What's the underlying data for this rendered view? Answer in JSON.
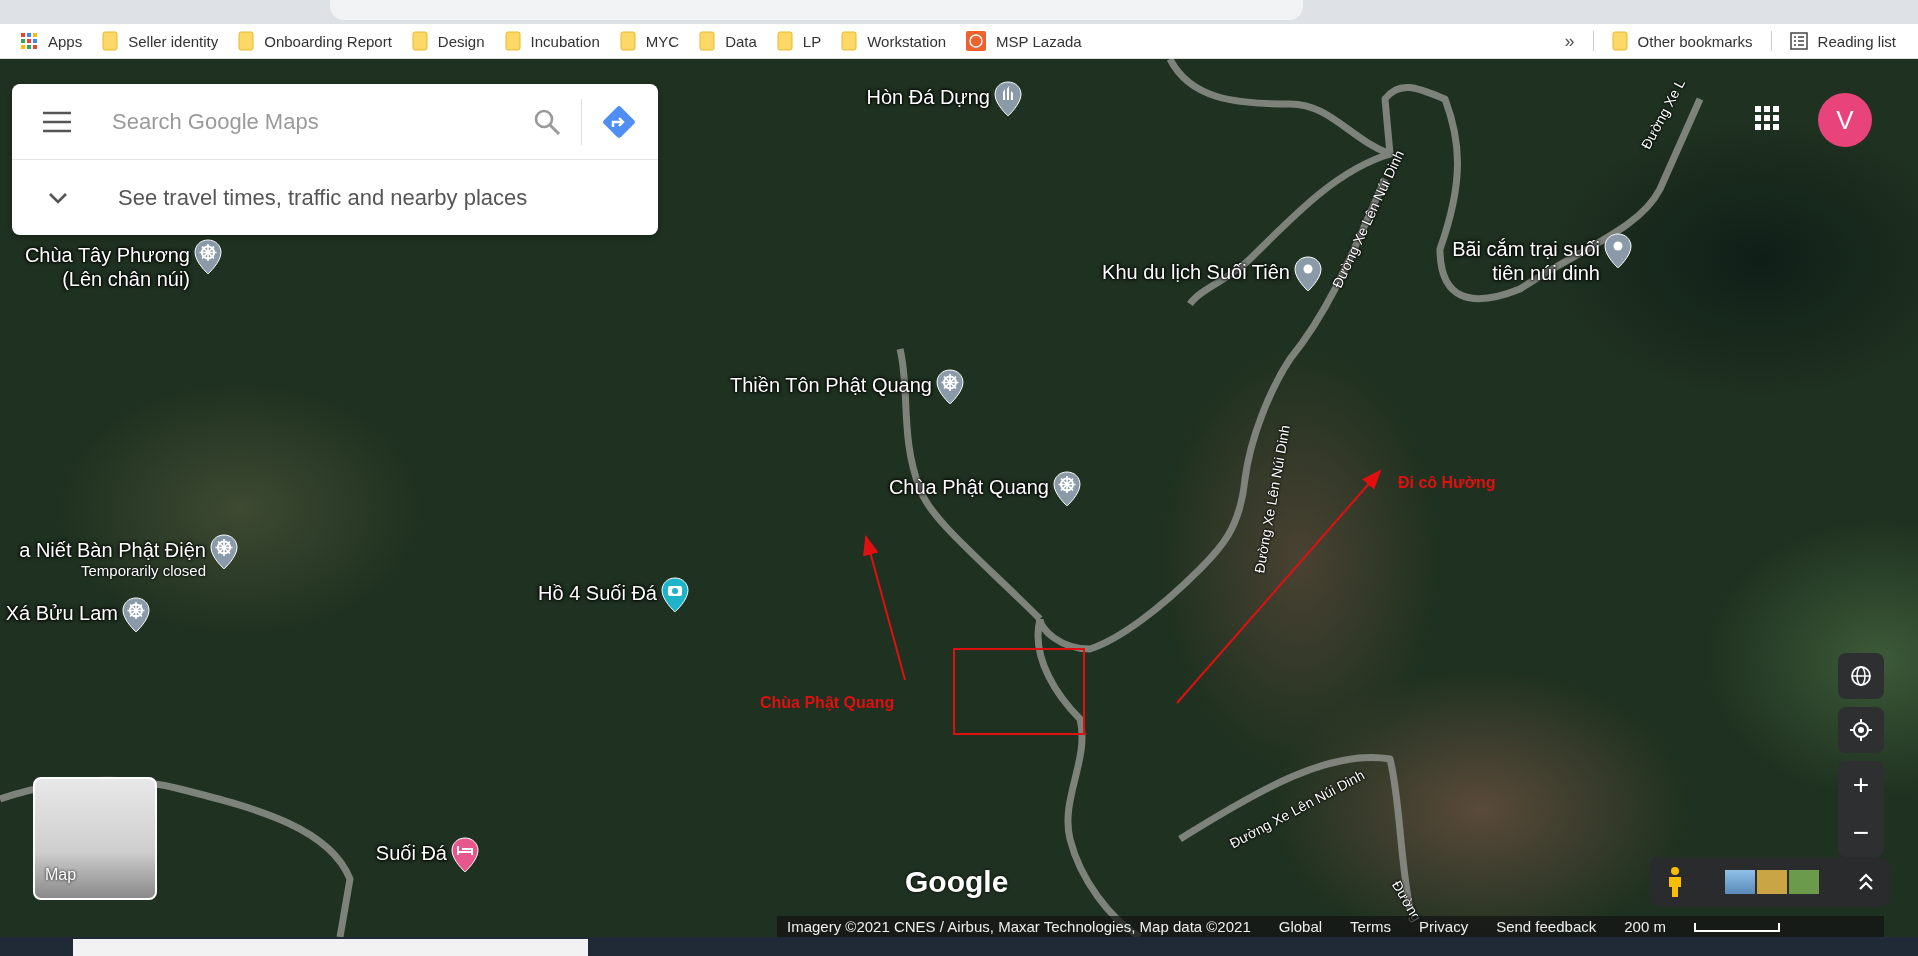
{
  "browser": {
    "bookmarks": [
      {
        "label": "Apps",
        "kind": "apps"
      },
      {
        "label": "Seller identity",
        "kind": "folder"
      },
      {
        "label": "Onboarding Report",
        "kind": "folder"
      },
      {
        "label": "Design",
        "kind": "folder"
      },
      {
        "label": "Incubation",
        "kind": "folder"
      },
      {
        "label": "MYC",
        "kind": "folder"
      },
      {
        "label": "Data",
        "kind": "folder"
      },
      {
        "label": "LP",
        "kind": "folder"
      },
      {
        "label": "Workstation",
        "kind": "folder"
      },
      {
        "label": "MSP Lazada",
        "kind": "site"
      }
    ],
    "overflow": "»",
    "other_bookmarks": "Other bookmarks",
    "reading_list": "Reading list"
  },
  "map": {
    "search": {
      "placeholder": "Search Google Maps"
    },
    "travel_prompt": "See travel times, traffic and nearby places",
    "account_initial": "V",
    "places": [
      {
        "lines": [
          "Hòn Đá Dựng"
        ],
        "kind": "landmark"
      },
      {
        "lines": [
          "Chùa Tây Phương",
          "(Lên chân núi)"
        ],
        "kind": "temple"
      },
      {
        "lines": [
          "Khu du lịch Suối Tiên"
        ],
        "kind": "pin"
      },
      {
        "lines": [
          "Bãi cắm trại suối",
          "tiên núi dinh"
        ],
        "kind": "pin"
      },
      {
        "lines": [
          "Thiền Tôn Phật Quang"
        ],
        "kind": "temple"
      },
      {
        "lines": [
          "Chùa Phật Quang"
        ],
        "kind": "temple"
      },
      {
        "lines": [
          "a Niết Bàn Phật Điện"
        ],
        "note": "Temporarily closed",
        "kind": "temple"
      },
      {
        "lines": [
          "Hồ 4 Suối Đá"
        ],
        "kind": "camera"
      },
      {
        "lines": [
          "Xá Bửu Lam"
        ],
        "kind": "temple"
      },
      {
        "lines": [
          "Suối Đá"
        ],
        "kind": "hotel"
      }
    ],
    "road_labels": [
      "Đường Xe L",
      "Đường Xe Lên Núi Dinh",
      "Đường Xe Lên Núi Dinh",
      "Đường Xe Lên Núi Dinh",
      "Đường"
    ],
    "annotations": [
      "Chùa Phật Quang",
      "Đi cô Hường"
    ],
    "layer_toggle": "Map",
    "logo": "Google",
    "attribution": [
      "Imagery ©2021 CNES / Airbus, Maxar Technologies, Map data ©2021",
      "Global",
      "Terms",
      "Privacy",
      "Send feedback"
    ],
    "scale": "200 m",
    "zoom_in": "+",
    "zoom_out": "−"
  }
}
